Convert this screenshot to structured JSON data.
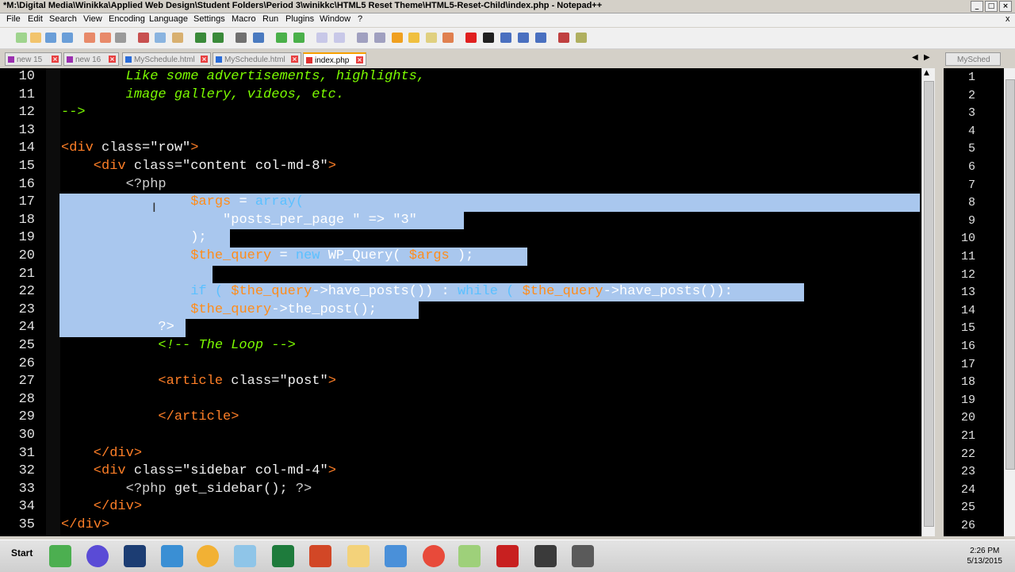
{
  "window": {
    "title": "*M:\\Digital Media\\Winikka\\Applied Web Design\\Student Folders\\Period 3\\winikkc\\HTML5 Reset Theme\\HTML5-Reset-Child\\index.php - Notepad++",
    "close": "x"
  },
  "menu": [
    "File",
    "Edit",
    "Search",
    "View",
    "Encoding",
    "Language",
    "Settings",
    "Macro",
    "Run",
    "Plugins",
    "Window",
    "?"
  ],
  "tabs": [
    {
      "label": "new 15"
    },
    {
      "label": "new 16"
    },
    {
      "label": "MySchedule.html"
    },
    {
      "label": "MySchedule.html"
    },
    {
      "label": "index.php",
      "active": true
    }
  ],
  "right_tab": {
    "label": "MySched"
  },
  "editor": {
    "lines": [
      {
        "n": "10",
        "segs": [
          [
            "        Like some advertisements, highlights,",
            "cm"
          ]
        ]
      },
      {
        "n": "11",
        "segs": [
          [
            "        image gallery, videos, etc.",
            "cm"
          ]
        ]
      },
      {
        "n": "12",
        "segs": [
          [
            "-->",
            "cm"
          ]
        ]
      },
      {
        "n": "13",
        "segs": []
      },
      {
        "n": "14",
        "segs": [
          [
            "<div ",
            "tg"
          ],
          [
            "class=",
            "at"
          ],
          [
            "\"row\"",
            "st"
          ],
          [
            ">",
            "tg"
          ]
        ]
      },
      {
        "n": "15",
        "segs": [
          [
            "    <div ",
            "tg"
          ],
          [
            "class=",
            "at"
          ],
          [
            "\"content col-md-8\"",
            "st"
          ],
          [
            ">",
            "tg"
          ]
        ]
      },
      {
        "n": "16",
        "segs": [
          [
            "        <?php",
            "ph"
          ]
        ]
      },
      {
        "n": "17",
        "segs": [
          [
            "                ",
            "pl"
          ],
          [
            "$args",
            "va"
          ],
          [
            " = ",
            "op"
          ],
          [
            "array(",
            "kw"
          ]
        ],
        "sel": [
          75,
          212,
          1160
        ]
      },
      {
        "n": "18",
        "segs": [
          [
            "                    ",
            "pl"
          ],
          [
            "\"posts_per_page \" => \"3\"",
            "s2"
          ]
        ],
        "sel": [
          75,
          212,
          585
        ]
      },
      {
        "n": "19",
        "segs": [
          [
            "                ",
            "pl"
          ],
          [
            ");",
            "op"
          ]
        ],
        "sel": [
          75,
          212,
          290
        ]
      },
      {
        "n": "20",
        "segs": [
          [
            "                ",
            "pl"
          ],
          [
            "$the_query",
            "va"
          ],
          [
            " = ",
            "op"
          ],
          [
            "new ",
            "kw"
          ],
          [
            "WP_Query( ",
            "fn"
          ],
          [
            "$args",
            "va"
          ],
          [
            " );",
            "op"
          ]
        ],
        "sel": [
          75,
          212,
          665
        ]
      },
      {
        "n": "21",
        "segs": [],
        "sel": [
          75,
          212,
          268
        ]
      },
      {
        "n": "22",
        "segs": [
          [
            "                ",
            "pl"
          ],
          [
            "if ( ",
            "kw"
          ],
          [
            "$the_query",
            "va"
          ],
          [
            "->",
            "op"
          ],
          [
            "have_posts",
            "fn"
          ],
          [
            "()) : ",
            "op"
          ],
          [
            "while ( ",
            "kw"
          ],
          [
            "$the_query",
            "va"
          ],
          [
            "->",
            "op"
          ],
          [
            "have_posts",
            "fn"
          ],
          [
            "()):",
            "op"
          ]
        ],
        "sel": [
          75,
          212,
          1014
        ]
      },
      {
        "n": "23",
        "segs": [
          [
            "                ",
            "pl"
          ],
          [
            "$the_query",
            "va"
          ],
          [
            "->",
            "op"
          ],
          [
            "the_post",
            "fn"
          ],
          [
            "();",
            "op"
          ]
        ],
        "sel": [
          75,
          212,
          528
        ]
      },
      {
        "n": "24",
        "segs": [
          [
            "            ",
            "pl"
          ],
          [
            "?>",
            "op"
          ]
        ],
        "sel": [
          75,
          75,
          234
        ]
      },
      {
        "n": "25",
        "segs": [
          [
            "            <!-- The Loop -->",
            "cm"
          ]
        ]
      },
      {
        "n": "26",
        "segs": []
      },
      {
        "n": "27",
        "segs": [
          [
            "            <article ",
            "tg"
          ],
          [
            "class=",
            "at"
          ],
          [
            "\"post\"",
            "st"
          ],
          [
            ">",
            "tg"
          ]
        ]
      },
      {
        "n": "28",
        "segs": []
      },
      {
        "n": "29",
        "segs": [
          [
            "            </article>",
            "tg"
          ]
        ]
      },
      {
        "n": "30",
        "segs": []
      },
      {
        "n": "31",
        "segs": [
          [
            "    </div>",
            "tg"
          ]
        ]
      },
      {
        "n": "32",
        "segs": [
          [
            "    <div ",
            "tg"
          ],
          [
            "class=",
            "at"
          ],
          [
            "\"sidebar col-md-4\"",
            "st"
          ],
          [
            ">",
            "tg"
          ]
        ]
      },
      {
        "n": "33",
        "segs": [
          [
            "        <?php ",
            "ph"
          ],
          [
            "get_sidebar(); ",
            "pl2"
          ],
          [
            "?>",
            "ph"
          ]
        ]
      },
      {
        "n": "34",
        "segs": [
          [
            "    </div>",
            "tg"
          ]
        ]
      },
      {
        "n": "35",
        "segs": [
          [
            "</div>",
            "tg"
          ]
        ]
      }
    ]
  },
  "right_line_numbers": [
    "1",
    "2",
    "3",
    "4",
    "5",
    "6",
    "7",
    "8",
    "9",
    "10",
    "11",
    "12",
    "13",
    "14",
    "15",
    "16",
    "17",
    "18",
    "19",
    "20",
    "21",
    "22",
    "23",
    "24",
    "25",
    "26"
  ],
  "taskbar": {
    "start": "Start",
    "time": "2:26 PM",
    "date": "5/13/2015"
  },
  "colors": {
    "tag": "#ff7f27",
    "attr": "#e8e8e8",
    "string": "#f2f2f2",
    "comment": "#7cfc00",
    "php": "#d0d0d0",
    "selection": "#a9c7ee",
    "var": "#ff8c1a",
    "keyword": "#5bc0ff",
    "sel_string": "#ffffff"
  }
}
